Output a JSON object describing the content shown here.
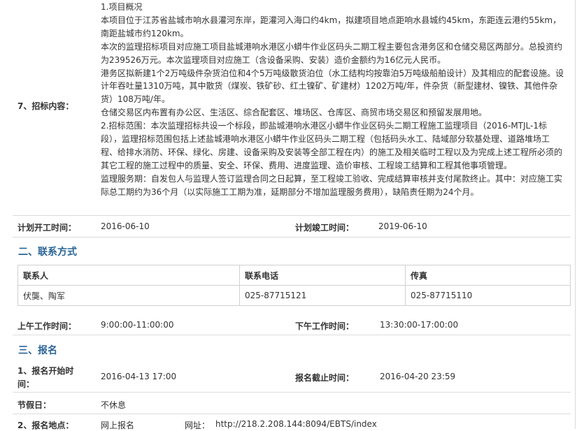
{
  "bid_content": {
    "label": "7、招标内容：",
    "paragraphs": [
      "1.项目概况",
      "本项目位于江苏省盐城市响水县灌河东岸，距灌河入海口约4km，拟建项目地点距响水县城约45km，东距连云港约55km，南距盐城市约120km。",
      "本次的监理招标项目对应施工项目盐城港响水港区小蟒牛作业区码头二期工程主要包含港务区和仓储交易区两部分。总投资约为239526万元。本次监理项目对应施工（含设备采购、安装）造价金额约为16亿元人民币。",
      "港务区拟新建1个2万吨级件杂货泊位和4个5万吨级散货泊位（水工结构均按靠泊5万吨级船舶设计）及其相应的配套设施。设计年吞吐量1310万吨，其中散货（煤炭、铁矿砂、红土镍矿、矿建材）1202万吨/年，件杂货（新型建材、镍铁、其他件杂货）108万吨/年。",
      "仓储交易区内布置有办公区、生活区、综合配套区、堆场区、仓库区、商贸市场交易区和预留发展用地。",
      "2.招标范围：本次监理招标共设一个标段，即盐城港响水港区小蟒牛作业区码头二期工程施工监理项目（2016-MTJL-1标段），监理招标范围包括上述盐城港响水港区小蟒牛作业区码头二期工程（包括码头水工、陆域部分软基处理、道路堆场工程、给排水消防、环保、绿化、房建、设备采购及安装等全部工程在内）的施工及相关临时工程以及为完成上述工程所必须的其它工程的施工过程中的质量、安全、环保、费用、进度监理、造价审核、工程竣工结算和工程其他事项管理。",
      "监理服务期：自发包人与监理人签订监理合同之日起算，至工程竣工验收、完成结算审核并支付尾款终止。其中：对应施工实际总工期约为36个月（以实际施工工期为准，延期部分不增加监理服务费用），缺陷责任期为24个月。"
    ]
  },
  "schedule": {
    "start_label": "计划开工时间：",
    "start_value": "2016-06-10",
    "end_label": "计划竣工时间：",
    "end_value": "2019-06-10"
  },
  "contact_section": {
    "title": "二、联系方式",
    "headers": [
      "联系人",
      "联系电话",
      "传真"
    ],
    "row": [
      "伏龑、陶军",
      "025-87715121",
      "025-87715110"
    ]
  },
  "work_hours": {
    "am_label": "上午工作时间：",
    "am_value": "9:00:00-11:00:00",
    "pm_label": "下午工作时间：",
    "pm_value": "13:30:00-17:00:00"
  },
  "signup_section": {
    "title": "三、报名",
    "start_label_line1": "1、报名开始时",
    "start_label_line2": "间：",
    "start_value": "2016-04-13 17:00",
    "deadline_label": "报名截止时间：",
    "deadline_value": "2016-04-20 23:59",
    "holiday_label": "节假日：",
    "holiday_value": "不休息",
    "location_label": "2、报名地点：",
    "location_value": "网上报名",
    "url_label": "网址：",
    "url_value": "http://218.2.208.144:8094/EBTS/index"
  }
}
